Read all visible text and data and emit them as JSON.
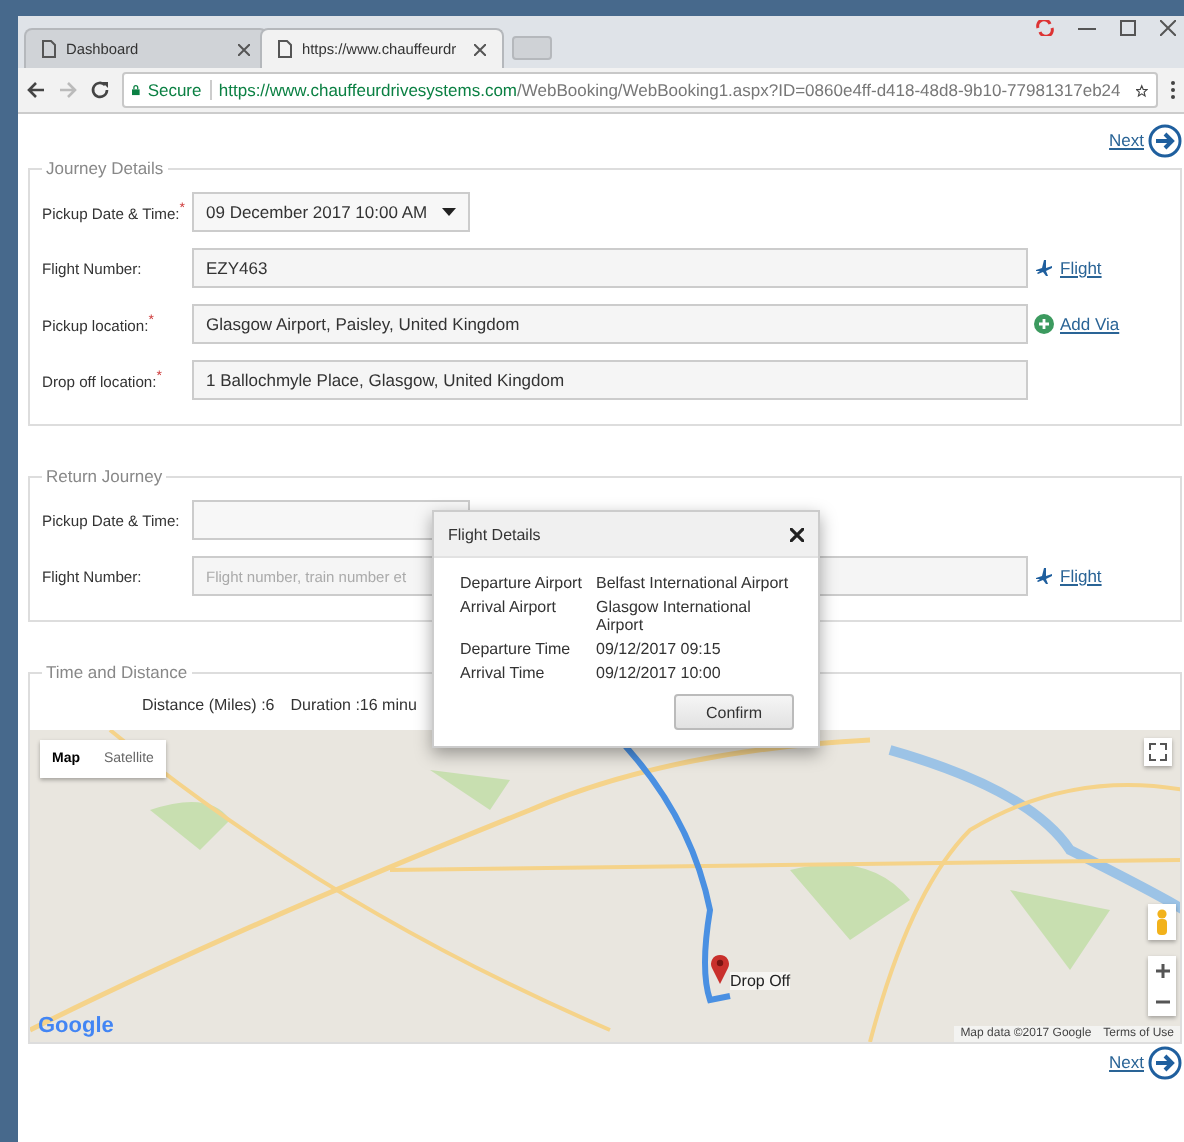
{
  "browser": {
    "tabs": [
      {
        "title": "Dashboard",
        "selected": false
      },
      {
        "title": "https://www.chauffeurdr",
        "selected": true
      }
    ],
    "secure_label": "Secure",
    "url_host": "https://www.chauffeurdrivesystems.com",
    "url_path": "/WebBooking/WebBooking1.aspx?ID=0860e4ff-d418-48d8-9b10-77981317eb24"
  },
  "next_top": "Next",
  "journey": {
    "legend": "Journey Details",
    "fields": [
      {
        "kind": "select",
        "label": "Pickup Date & Time:$^{*}$",
        "value": "09 December 2017 10:00 AM"
      },
      {
        "kind": "text",
        "label": "Flight Number:",
        "value": "EZY463",
        "action": {
          "kind": "flight",
          "label": "Flight"
        }
      },
      {
        "kind": "text",
        "label": "Pickup location:$^{*}$",
        "value": "Glasgow Airport, Paisley, United Kingdom",
        "action": {
          "kind": "add",
          "label": "Add Via"
        }
      },
      {
        "kind": "text",
        "label": "Drop off location:$^{*}$",
        "value": "1 Ballochmyle Place, Glasgow, United Kingdom"
      }
    ]
  },
  "return_journey": {
    "legend": "Return Journey",
    "fields": [
      {
        "kind": "select",
        "label": "Pickup Date & Time:"
      },
      {
        "kind": "text",
        "label": "Flight Number:",
        "placeholder": "Flight number, train number et",
        "action": {
          "kind": "flight",
          "label": "Flight"
        }
      }
    ]
  },
  "time_distance": {
    "legend": "Time and Distance",
    "distance": "Distance (Miles) :6",
    "duration": "Duration :16 minu",
    "map": {
      "view_tabs": [
        {
          "label": "Map",
          "selected": true
        },
        {
          "label": "Satellite",
          "selected": false
        }
      ],
      "marker_label": "Drop Off",
      "logo": "Google",
      "attribution": "Map data ©2017 Google",
      "terms": "Terms of Use"
    }
  },
  "next_bottom": "Next",
  "flight_dialog": {
    "title": "Flight Details",
    "rows": [
      {
        "label": "Departure Airport",
        "value": "Belfast International Airport"
      },
      {
        "label": "Arrival Airport",
        "value": "Glasgow International Airport"
      },
      {
        "label": "Departure Time",
        "value": "09/12/2017 09:15"
      },
      {
        "label": "Arrival Time",
        "value": "09/12/2017 10:00"
      }
    ],
    "button": "Confirm"
  }
}
